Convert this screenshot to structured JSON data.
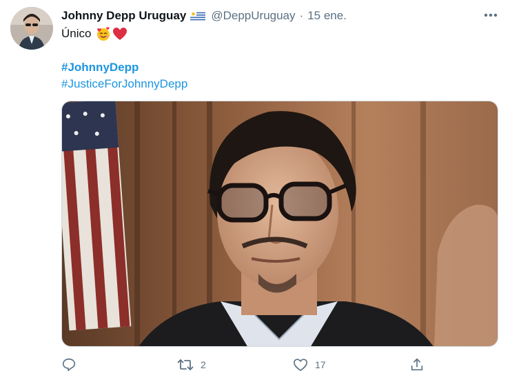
{
  "tweet": {
    "author_name": "Johnny Depp Uruguay",
    "handle": "@DeppUruguay",
    "separator": "·",
    "timestamp": "15 ene.",
    "text": "Único",
    "emojis": [
      "smiling-face-with-hearts",
      "red-heart"
    ],
    "hashtags": [
      "#JohnnyDepp",
      "#JusticeForJohnnyDepp"
    ],
    "media_alt": "photo of man with glasses",
    "flag": "uruguay-flag"
  },
  "actions": {
    "reply_count": "",
    "retweet_count": "2",
    "like_count": "17"
  },
  "colors": {
    "link": "#1b95e0",
    "secondary_text": "#5b7083",
    "primary_text": "#0f1419"
  }
}
